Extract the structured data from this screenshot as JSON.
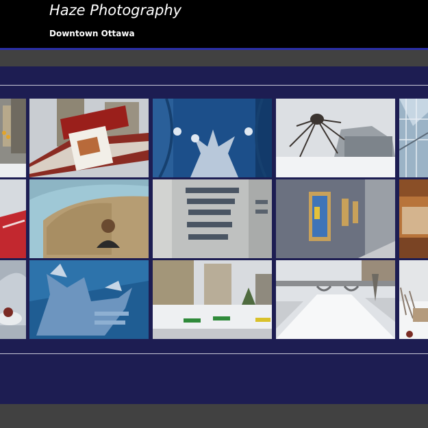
{
  "site": {
    "title": "Haze Photography",
    "subtitle": "Downtown Ottawa"
  },
  "colors": {
    "header_bg": "#000000",
    "accent_rule": "#2b2fa8",
    "nav_bg": "#414141",
    "page_bg": "#1d1d52"
  },
  "gallery": {
    "photos": [
      "city-street-edge-photo",
      "beavertails-stand-photo",
      "ice-sculpture-photo",
      "maman-spider-sculpture-photo",
      "glass-atrium-photo",
      "red-sign-photo",
      "museum-curved-wall-portrait-photo",
      "european-american-galleries-sign-photo",
      "gallery-corridor-painting-photo",
      "gallery-hall-edge-photo",
      "glass-dome-dessert-photo",
      "winterlude-snow-sculpture-photo",
      "winter-plaza-photo",
      "rideau-canal-bridge-photo",
      "winter-park-edge-photo"
    ]
  }
}
